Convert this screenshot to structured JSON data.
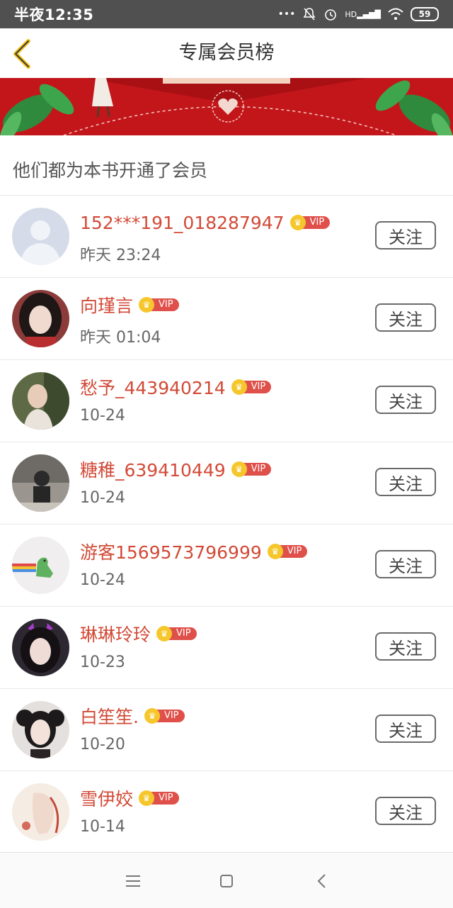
{
  "status_bar": {
    "time": "半夜12:35",
    "network": "HD",
    "battery": "59"
  },
  "header": {
    "title": "专属会员榜"
  },
  "section": {
    "title": "他们都为本书开通了会员"
  },
  "vip_label": "VIP",
  "follow_label": "关注",
  "members": [
    {
      "name": "152***191_018287947",
      "date": "昨天 23:24",
      "avatar": "default-avatar"
    },
    {
      "name": "向瑾言",
      "date": "昨天 01:04",
      "avatar": "girl-avatar"
    },
    {
      "name": "愁予_443940214",
      "date": "10-24",
      "avatar": "photo-avatar"
    },
    {
      "name": "糖稚_639410449",
      "date": "10-24",
      "avatar": "photo-avatar"
    },
    {
      "name": "游客1569573796999",
      "date": "10-24",
      "avatar": "dinosaur-avatar"
    },
    {
      "name": "琳琳玲玲",
      "date": "10-23",
      "avatar": "girl-avatar"
    },
    {
      "name": "白笙笙.",
      "date": "10-20",
      "avatar": "girl-avatar"
    },
    {
      "name": "雪伊姣",
      "date": "10-14",
      "avatar": "drawing-avatar"
    }
  ],
  "colors": {
    "accent": "#d24a37",
    "vip_tag": "#e0504a",
    "crown": "#f5c72c",
    "banner": "#c3161b"
  }
}
